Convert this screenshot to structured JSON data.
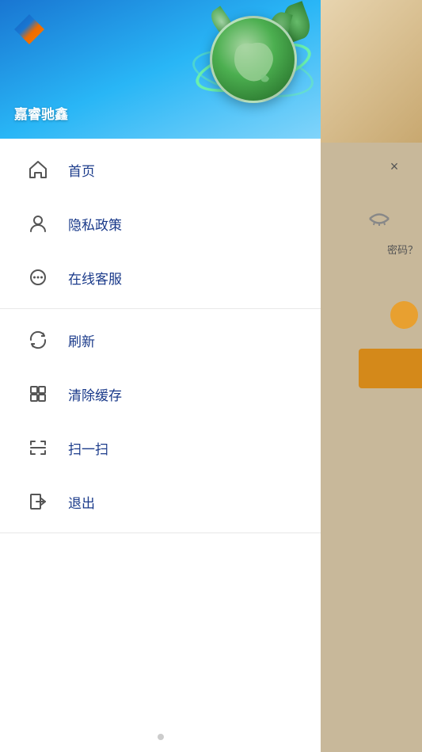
{
  "brand": {
    "name": "嘉睿驰鑫",
    "logo_alt": "diamond logo"
  },
  "menu": {
    "section1": [
      {
        "id": "home",
        "label": "首页",
        "icon": "⌂",
        "icon_name": "home-icon"
      },
      {
        "id": "privacy",
        "label": "隐私政策",
        "icon": "person",
        "icon_name": "person-icon"
      },
      {
        "id": "customer-service",
        "label": "在线客服",
        "icon": "chat",
        "icon_name": "chat-icon"
      }
    ],
    "section2": [
      {
        "id": "refresh",
        "label": "刷新",
        "icon": "refresh",
        "icon_name": "refresh-icon"
      },
      {
        "id": "clear-cache",
        "label": "清除缓存",
        "icon": "cache",
        "icon_name": "cache-icon"
      },
      {
        "id": "scan",
        "label": "扫一扫",
        "icon": "scan",
        "icon_name": "scan-icon"
      },
      {
        "id": "logout",
        "label": "退出",
        "icon": "logout",
        "icon_name": "logout-icon"
      }
    ]
  },
  "right_panel": {
    "close_label": "×",
    "password_hint": "密码？",
    "eye_icon": "👁",
    "close_icon": "×"
  }
}
